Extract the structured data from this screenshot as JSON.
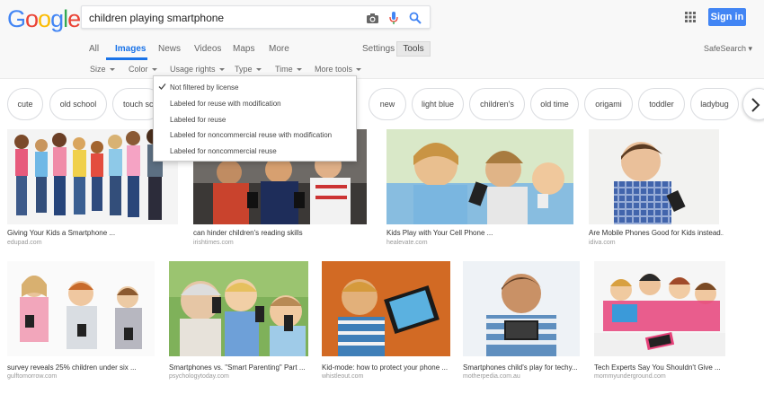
{
  "header": {
    "logo": "Google",
    "search_value": "children playing smartphone",
    "signin_label": "Sign in"
  },
  "tabs": [
    {
      "label": "All"
    },
    {
      "label": "Images"
    },
    {
      "label": "News"
    },
    {
      "label": "Videos"
    },
    {
      "label": "Maps"
    },
    {
      "label": "More"
    }
  ],
  "settings_label": "Settings",
  "tools_label": "Tools",
  "safesearch_label": "SafeSearch ▾",
  "filters": [
    {
      "label": "Size"
    },
    {
      "label": "Color"
    },
    {
      "label": "Usage rights"
    },
    {
      "label": "Type"
    },
    {
      "label": "Time"
    },
    {
      "label": "More tools"
    }
  ],
  "chips": [
    {
      "label": "cute"
    },
    {
      "label": "old school"
    },
    {
      "label": "touch sc"
    },
    {
      "label": "new"
    },
    {
      "label": "light blue"
    },
    {
      "label": "children's"
    },
    {
      "label": "old time"
    },
    {
      "label": "origami"
    },
    {
      "label": "toddler"
    },
    {
      "label": "ladybug"
    }
  ],
  "usage_rights_menu": [
    {
      "label": "Not filtered by license",
      "checked": true
    },
    {
      "label": "Labeled for reuse with modification",
      "checked": false
    },
    {
      "label": "Labeled for reuse",
      "checked": false
    },
    {
      "label": "Labeled for noncommercial reuse with modification",
      "checked": false
    },
    {
      "label": "Labeled for noncommercial reuse",
      "checked": false
    }
  ],
  "results": [
    {
      "title": "Giving Your Kids a Smartphone ...",
      "source": "edupad.com"
    },
    {
      "title": "can hinder children's reading skills",
      "source": "irishtimes.com"
    },
    {
      "title": "Kids Play with Your Cell Phone ...",
      "source": "healevate.com"
    },
    {
      "title": "Are Mobile Phones Good for Kids instead...",
      "source": "idiva.com"
    },
    {
      "title": "survey reveals 25% children under six ...",
      "source": "gulftomorrow.com"
    },
    {
      "title": "Smartphones vs. \"Smart Parenting\" Part ...",
      "source": "psychologytoday.com"
    },
    {
      "title": "Kid-mode: how to protect your phone ...",
      "source": "whistleout.com"
    },
    {
      "title": "Smartphones child's play for techy...",
      "source": "motherpedia.com.au"
    },
    {
      "title": "Tech Experts Say You Shouldn't Give ...",
      "source": "mommyunderground.com"
    }
  ],
  "colors": {
    "blue": "#4285f4",
    "red": "#ea4335",
    "yellow": "#fbbc05",
    "green": "#34a853",
    "active_tab": "#1a73e8"
  }
}
